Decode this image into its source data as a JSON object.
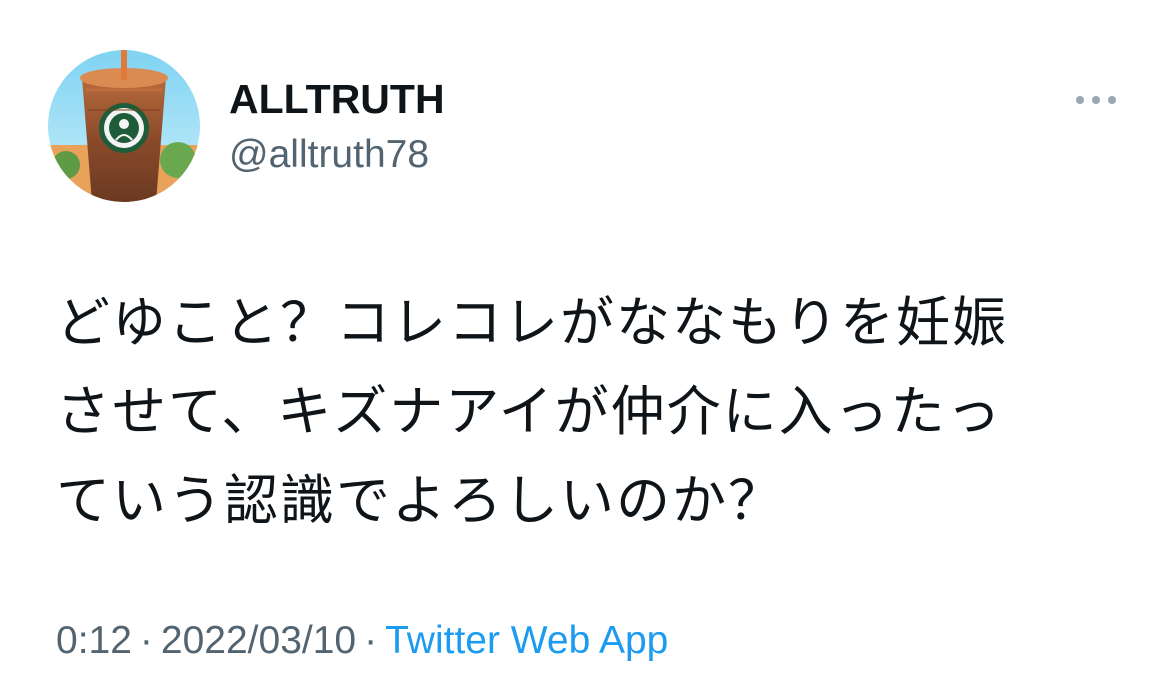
{
  "tweet": {
    "author": {
      "display_name": "ALLTRUTH",
      "handle": "@alltruth78",
      "avatar_icon": "profile-avatar"
    },
    "more_icon": "more-dots-icon",
    "text": "どゆこと？コレコレがななもりを妊娠\nさせて、キズナアイが仲介に入ったっ\nていう認識でよろしいのか？",
    "meta": {
      "time": "0:12",
      "separator": "·",
      "date": "2022/03/10",
      "source": "Twitter Web App"
    }
  },
  "colors": {
    "text_primary": "#0f1419",
    "text_secondary": "#536471",
    "link": "#1d9bf0",
    "background": "#ffffff"
  }
}
